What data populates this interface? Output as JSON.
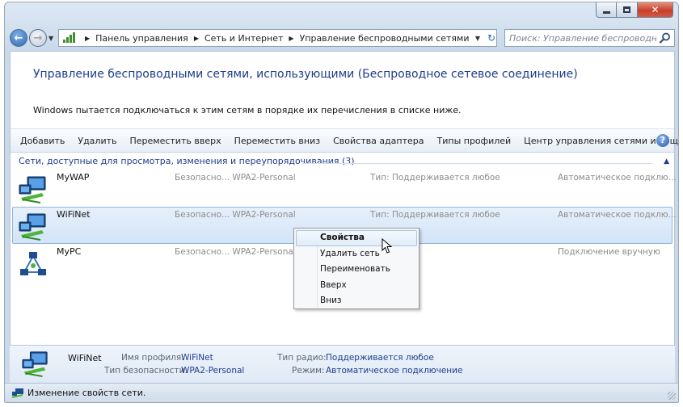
{
  "window": {
    "minimize_glyph": "▁",
    "maximize_glyph": "□",
    "close_glyph": "✕"
  },
  "address_bar": {
    "breadcrumbs": [
      "Панель управления",
      "Сеть и Интернет",
      "Управление беспроводными сетями"
    ],
    "search_placeholder": "Поиск: Управление беспроводными сетями"
  },
  "page": {
    "title": "Управление беспроводными сетями, использующими (Беспроводное сетевое соединение)",
    "description": "Windows пытается подключаться к этим сетям в порядке их перечисления в списке ниже."
  },
  "toolbar": {
    "items": [
      "Добавить",
      "Удалить",
      "Переместить вверх",
      "Переместить вниз",
      "Свойства адаптера",
      "Типы профилей",
      "Центр управления сетями и общим доступом"
    ],
    "help_label": "?"
  },
  "group": {
    "header": "Сети, доступные для просмотра, изменения и переупорядочивания (3)",
    "caret": "▲"
  },
  "networks": [
    {
      "name": "MyWAP",
      "security": "Безопасно...  WPA2-Personal",
      "type": "Тип:  Поддерживается любое",
      "mode": "Автоматическое подклю...",
      "icon": "wireless-network-icon"
    },
    {
      "name": "WiFiNet",
      "security": "Безопасно...  WPA2-Personal",
      "type": "Тип:  Поддерживается любое",
      "mode": "Автоматическое подклю...",
      "icon": "wireless-network-icon",
      "selected": true
    },
    {
      "name": "MyPC",
      "security": "Безопасно...  WPA2-Personal",
      "type": "",
      "mode": "Подключение вручную",
      "icon": "adhoc-network-icon"
    }
  ],
  "context_menu": {
    "items": [
      "Свойства",
      "Удалить сеть",
      "Переименовать",
      "Вверх",
      "Вниз"
    ],
    "default_item": "Свойства"
  },
  "details": {
    "name": "WiFiNet",
    "profile_label": "Имя профиля:",
    "profile_value": "WiFiNet",
    "security_label": "Тип безопасности:",
    "security_value": "WPA2-Personal",
    "radio_label": "Тип радио:",
    "radio_value": "Поддерживается любое",
    "mode_label": "Режим:",
    "mode_value": "Автоматическое подключение"
  },
  "status_bar": {
    "text": "Изменение свойств сети."
  },
  "colors": {
    "title_blue": "#1f3c8c",
    "selection": "#d3e4f7",
    "selection_border": "#8fb3dc",
    "close_red": "#c6402b"
  }
}
